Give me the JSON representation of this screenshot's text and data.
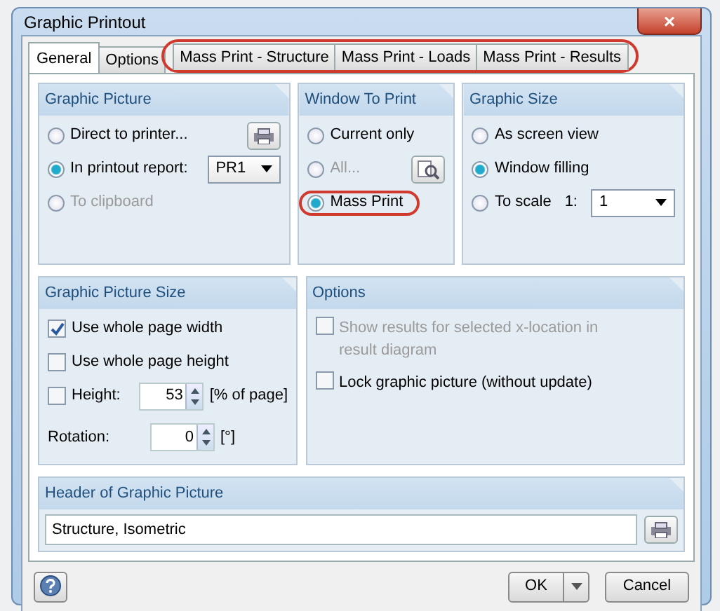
{
  "window": {
    "title": "Graphic Printout",
    "close": "×"
  },
  "tabs": [
    {
      "label": "General",
      "selected": true,
      "highlighted": false
    },
    {
      "label": "Options",
      "selected": false,
      "highlighted": false
    },
    {
      "label": "Mass Print - Structure",
      "selected": false,
      "highlighted": true
    },
    {
      "label": "Mass Print - Loads",
      "selected": false,
      "highlighted": true
    },
    {
      "label": "Mass Print - Results",
      "selected": false,
      "highlighted": true
    }
  ],
  "graphic_picture": {
    "title": "Graphic Picture",
    "report": "PR1",
    "options": [
      {
        "label": "Direct to printer...",
        "selected": false,
        "disabled": false,
        "has_button": true
      },
      {
        "label": "In printout report:",
        "selected": true,
        "disabled": false,
        "has_button": false
      },
      {
        "label": "To clipboard",
        "selected": false,
        "disabled": true,
        "has_button": false
      }
    ]
  },
  "window_to_print": {
    "title": "Window To Print",
    "options": [
      {
        "label": "Current only",
        "selected": false,
        "disabled": false,
        "has_button": false,
        "highlighted": false
      },
      {
        "label": "All...",
        "selected": false,
        "disabled": true,
        "has_button": true,
        "highlighted": false
      },
      {
        "label": "Mass Print",
        "selected": true,
        "disabled": false,
        "has_button": false,
        "highlighted": true
      }
    ]
  },
  "graphic_size": {
    "title": "Graphic Size",
    "scale_label": "1:",
    "scale_value": "1",
    "options": [
      {
        "label": "As screen view",
        "selected": false
      },
      {
        "label": "Window filling",
        "selected": true
      },
      {
        "label": "To scale",
        "selected": false
      }
    ]
  },
  "graphic_picture_size": {
    "title": "Graphic Picture Size",
    "checks": [
      {
        "label": "Use whole page width",
        "checked": true
      },
      {
        "label": "Use whole page height",
        "checked": false
      }
    ],
    "height": {
      "label": "Height:",
      "checked": false,
      "value": "53",
      "unit": "[% of page]"
    },
    "rotation": {
      "label": "Rotation:",
      "value": "0",
      "unit": "[°]"
    }
  },
  "options": {
    "title": "Options",
    "checks": [
      {
        "label": "Show results for selected x-location in result diagram",
        "checked": false,
        "disabled": true
      },
      {
        "label": "Lock graphic picture (without update)",
        "checked": false,
        "disabled": false
      }
    ]
  },
  "header": {
    "title": "Header of Graphic Picture",
    "value": "Structure, Isometric"
  },
  "buttons": {
    "ok": "OK",
    "cancel": "Cancel"
  }
}
